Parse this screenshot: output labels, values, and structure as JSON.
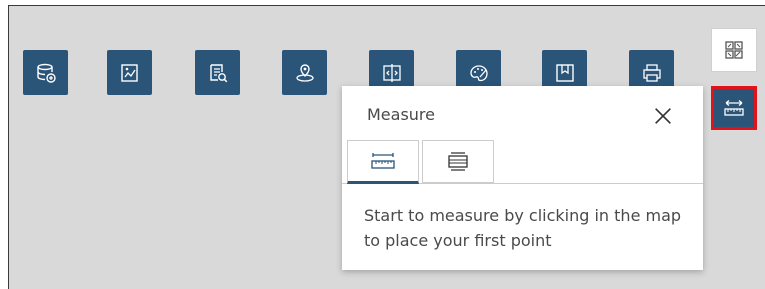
{
  "toolbar": {
    "buttons": [
      {
        "name": "layer-list-button",
        "icon": "database-add-icon"
      },
      {
        "name": "legend-button",
        "icon": "map-legend-icon"
      },
      {
        "name": "query-button",
        "icon": "document-search-icon"
      },
      {
        "name": "near-me-button",
        "icon": "location-pin-icon"
      },
      {
        "name": "swipe-button",
        "icon": "swipe-compare-icon"
      },
      {
        "name": "basemap-gallery-button",
        "icon": "palette-icon"
      },
      {
        "name": "bookmark-button",
        "icon": "bookmark-icon"
      },
      {
        "name": "print-button",
        "icon": "printer-icon"
      }
    ]
  },
  "side_toolbar": {
    "grid_icon": "widget-grid-icon",
    "measure_icon": "measure-ruler-icon"
  },
  "popup": {
    "title": "Measure",
    "close_icon": "close-icon",
    "tabs": [
      {
        "icon": "distance-ruler-icon",
        "active": true
      },
      {
        "icon": "area-measure-icon",
        "active": false
      }
    ],
    "instructions": "Start to measure by clicking in the map to place your first point"
  },
  "colors": {
    "button_bg": "#2a5478",
    "map_bg": "#d9d9d9",
    "highlight": "#e0121a",
    "text": "#4a4a4a"
  }
}
